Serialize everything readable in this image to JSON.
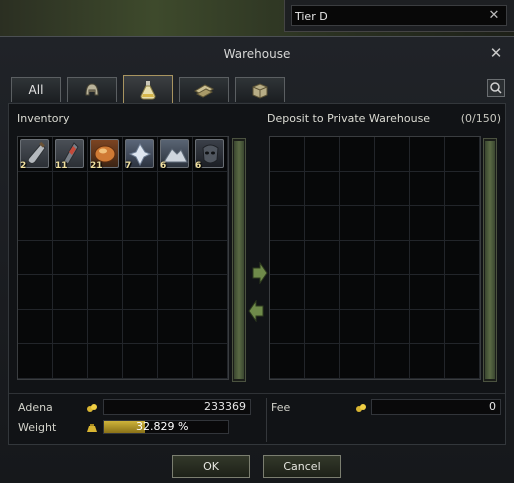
{
  "search": {
    "value": "Tier D"
  },
  "window": {
    "title": "Warehouse"
  },
  "tabs": [
    {
      "label": "All",
      "icon": "none"
    },
    {
      "label": "",
      "icon": "armor-helmet-icon"
    },
    {
      "label": "",
      "icon": "potion-flask-icon"
    },
    {
      "label": "",
      "icon": "material-bars-icon"
    },
    {
      "label": "",
      "icon": "box-package-icon"
    }
  ],
  "inventory": {
    "title": "Inventory",
    "items": [
      {
        "count": "2",
        "icon": "bottle-icon"
      },
      {
        "count": "11",
        "icon": "scroll-vial-icon"
      },
      {
        "count": "21",
        "icon": "orange-orb-icon"
      },
      {
        "count": "7",
        "icon": "crystal-shard-icon"
      },
      {
        "count": "6",
        "icon": "mithril-pile-icon"
      },
      {
        "count": "6",
        "icon": "dark-mask-icon"
      }
    ]
  },
  "deposit": {
    "title": "Deposit to Private Warehouse",
    "count": "(0/150)"
  },
  "footer": {
    "adena_label": "Adena",
    "adena_value": "233369",
    "weight_label": "Weight",
    "weight_text": "32.829 %",
    "weight_fraction": 0.32829,
    "fee_label": "Fee",
    "fee_value": "0"
  },
  "buttons": {
    "ok": "OK",
    "cancel": "Cancel"
  },
  "colors": {
    "accent_gold": "#c8a83a",
    "tab_active_border": "#a89460",
    "arrow_green": "#6f8a4a"
  }
}
